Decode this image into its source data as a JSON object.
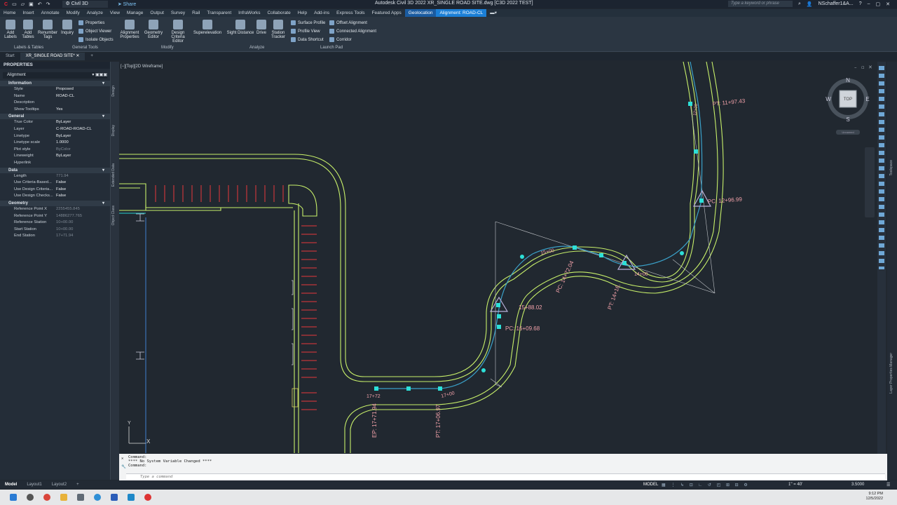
{
  "app": {
    "title": "Autodesk Civil 3D 2022   XR_SINGLE ROAD SITE.dwg [C3D 2022 TEST]",
    "workspace": "Civil 3D",
    "share_label": "Share",
    "search_placeholder": "Type a keyword or phrase",
    "user": "NSchaffer1&A..."
  },
  "menu": [
    "Home",
    "Insert",
    "Annotate",
    "Modify",
    "Analyze",
    "View",
    "Manage",
    "Output",
    "Survey",
    "Rail",
    "Transparent",
    "InfraWorks",
    "Collaborate",
    "Help",
    "Add-ins",
    "Express Tools",
    "Featured Apps",
    "Geolocation",
    "Alignment: ROAD-CL"
  ],
  "ribbon": {
    "labels_tables": {
      "add_labels": "Add Labels",
      "add_tables": "Add Tables",
      "renumber_tags": "Renumber Tags",
      "panel": "Labels & Tables"
    },
    "general_tools": {
      "properties": "Properties",
      "object_viewer": "Object Viewer",
      "isolate_objects": "Isolate Objects",
      "inquiry": "Inquiry",
      "panel": "General Tools"
    },
    "modify": {
      "alignment_properties": "Alignment Properties",
      "geometry_editor": "Geometry Editor",
      "design_criteria_editor": "Design Criteria Editor",
      "superelevation": "Superelevation",
      "panel": "Modify"
    },
    "analyze": {
      "sight_distance": "Sight Distance",
      "drive": "Drive",
      "station_tracker": "Station Tracker",
      "panel": "Analyze"
    },
    "launch_pad": {
      "surface_profile": "Surface Profile",
      "profile_view": "Profile View",
      "data_shortcut": "Data Shortcut",
      "offset_alignment": "Offset Alignment",
      "connected_alignment": "Connected Alignment",
      "corridor": "Corridor",
      "panel": "Launch Pad"
    }
  },
  "file_tabs": {
    "start": "Start",
    "active": "XR_SINGLE ROAD SITE*"
  },
  "properties": {
    "header": "PROPERTIES",
    "selector": "Alignment",
    "sections": {
      "information": {
        "title": "Information",
        "rows": [
          [
            "Style",
            "Proposed"
          ],
          [
            "Name",
            "ROAD-CL"
          ],
          [
            "Description",
            ""
          ],
          [
            "Show Tooltips",
            "Yes"
          ]
        ]
      },
      "general": {
        "title": "General",
        "rows": [
          [
            "True Color",
            "ByLayer"
          ],
          [
            "Layer",
            "C-ROAD-ROAD-CL"
          ],
          [
            "Linetype",
            "ByLayer"
          ],
          [
            "Linetype scale",
            "1.0000"
          ],
          [
            "Plot style",
            "ByColor"
          ],
          [
            "Lineweight",
            "ByLayer"
          ],
          [
            "Hyperlink",
            ""
          ]
        ]
      },
      "data": {
        "title": "Data",
        "rows": [
          [
            "Length",
            "771.94"
          ],
          [
            "Use Criteria-Based...",
            "False"
          ],
          [
            "Use Design Criteria...",
            "False"
          ],
          [
            "Use Design Checks...",
            "False"
          ]
        ]
      },
      "geometry": {
        "title": "Geometry",
        "rows": [
          [
            "Reference Point X",
            "2255455.845"
          ],
          [
            "Reference Point Y",
            "14886277.765"
          ],
          [
            "Reference Station",
            "10+00.00"
          ],
          [
            "Start Station",
            "10+00.00"
          ],
          [
            "End Station",
            "17+71.94"
          ]
        ]
      }
    }
  },
  "side_tabs": [
    "Design",
    "Display",
    "Extended Data",
    "Object Class"
  ],
  "viewport": {
    "label": "[−][Top][2D Wireframe]",
    "viewcube": {
      "top": "TOP",
      "n": "N",
      "s": "S",
      "e": "E",
      "w": "W",
      "wcs": "Unnamed"
    },
    "ucs": {
      "x": "X",
      "y": "Y"
    },
    "stations": {
      "pt_top": "PT: 11+97.43",
      "pi_top": "12+00",
      "pc_right": "PC: 12+96.99",
      "sta_14": "14+00",
      "pt_mid": "PT: 14+16.",
      "pc_mid": "PC: 14+72.04",
      "sta_15": "15+00",
      "sta_1588": "15+88.02",
      "pc_1609": "PC: 16+09.68",
      "sta_17": "17+00",
      "pt_low": "PT: 17+06.97",
      "ep": "EP: 17+71.94",
      "sta_1772": "17+72"
    }
  },
  "right_tabs": [
    "Toolspace",
    "Layer Properties Manager"
  ],
  "command": {
    "lines": [
      "Command:",
      "**** No System Variable Changed ****",
      "Command:"
    ],
    "placeholder": "Type a command"
  },
  "status": {
    "layouts": [
      "Model",
      "Layout1",
      "Layout2"
    ],
    "model": "MODEL",
    "scale": "1'' = 40'",
    "value": "3.5000"
  },
  "taskbar": {
    "time": "9:12 PM",
    "date": "12/5/2022"
  },
  "colors": {
    "road": "#c8f06a",
    "alignment": "#3aa0c8",
    "grips": "#2de0d8",
    "label": "#f0a0a8",
    "parking": "#e8383c",
    "accent": "#1b7fd6"
  }
}
